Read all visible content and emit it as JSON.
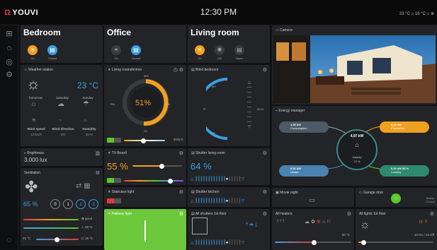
{
  "app": {
    "logo": "YOUVI",
    "time": "12:30 PM",
    "temp_out": "23 °C",
    "temp_in": "16 °C"
  },
  "rooms": [
    {
      "name": "Bedroom",
      "btn1": "On",
      "btn2": "Closed"
    },
    {
      "name": "Office",
      "btn1": "On",
      "btn2": "Closed"
    },
    {
      "name": "Living room",
      "btn1": "On",
      "btn2": "Off",
      "btn3": "Open"
    }
  ],
  "weather": {
    "title": "Weather station",
    "temp": "23 °C",
    "days": [
      "Tomorrow",
      "Saturday",
      "Sunday"
    ],
    "labels": [
      "Wind speed",
      "Wind direction",
      "Humidity"
    ],
    "values": [
      "13 km/h",
      "NO",
      "32 %"
    ]
  },
  "dimmer": {
    "title": "Living roomdimmer",
    "percent": "51%",
    "power": "3244 K",
    "ticks": [
      "0%",
      "25%",
      "50%",
      "75%",
      "100%"
    ]
  },
  "blind": {
    "title": "Blind bedroom",
    "angle_top": "90°",
    "angle_mid": "0°",
    "angle_bot": "-90°",
    "pct": "50 %"
  },
  "camera": {
    "title": "Camera"
  },
  "energy": {
    "title": "Energy manager",
    "consumption_val": "1,95 kW",
    "consumption_lbl": "Consumption",
    "production_val": "4,20 kW",
    "production_lbl": "Production",
    "storage_val": "0,00 kW",
    "storage_lbl": "Usage",
    "center_val": "4,97 kW",
    "autarky_lbl": "Autarky",
    "autarky_pct": "72 %",
    "car_val": "0,20 kW",
    "car_pct": "50 %",
    "car_lbl": "Loading"
  },
  "brightness": {
    "title": "Brightness",
    "value": "3.000 lux"
  },
  "tvboard": {
    "title": "TV-Board",
    "percent": "55 %"
  },
  "shutter_living": {
    "title": "Shutter living room",
    "percent": "64 %"
  },
  "ventilation": {
    "title": "Ventilation",
    "pct": "65 %",
    "levels": [
      "0",
      "1",
      "2",
      "3"
    ],
    "air": "good",
    "humidity": "50 %",
    "temp1": "21 °C",
    "temp2": "19 °C"
  },
  "staircase": {
    "title": "Staircase light"
  },
  "shutter_kitchen": {
    "title": "Shutter kitchen"
  },
  "movie": {
    "title": "Movie night"
  },
  "garage": {
    "title": "Garage door",
    "status": "Status:",
    "status_val": "Closed"
  },
  "hallway": {
    "title": "Hallway light"
  },
  "shutters1": {
    "title": "All shutters 1st floor"
  },
  "heaters": {
    "title": "All heaters",
    "temp": "20 °C"
  },
  "lights1": {
    "title": "All lights 1st floor",
    "count": "10 On / 24 Off"
  },
  "colors": {
    "accent_blue": "#3aa0e0",
    "accent_orange": "#f0a020",
    "accent_green": "#5ac82a",
    "panel": "#232427",
    "bg": "#111214"
  }
}
